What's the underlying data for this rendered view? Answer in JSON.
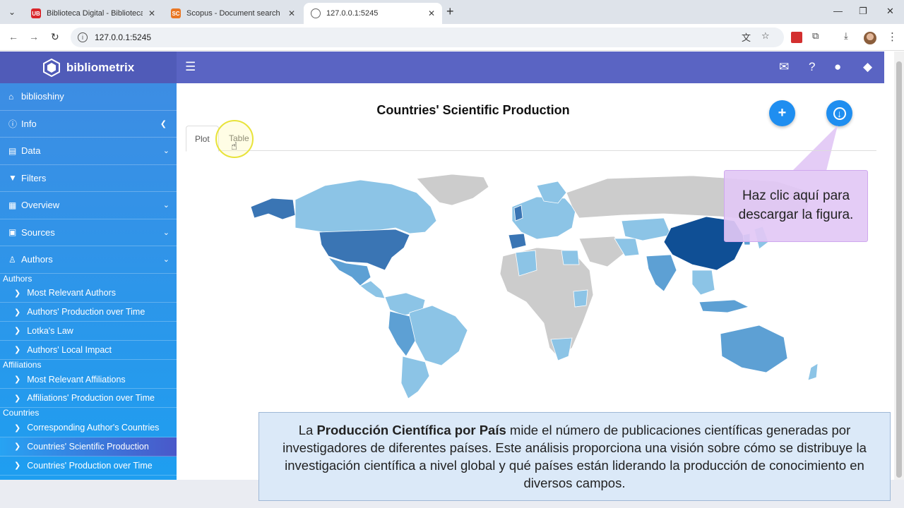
{
  "browser": {
    "tabs": [
      {
        "title": "Biblioteca Digital - Biblioteca -",
        "favicon_text": "UB",
        "color": "#d9262b"
      },
      {
        "title": "Scopus - Document search resu",
        "favicon_text": "SC",
        "color": "#e97724"
      },
      {
        "title": "127.0.0.1:5245",
        "favicon_text": "",
        "color": "#666666"
      }
    ],
    "url": "127.0.0.1:5245"
  },
  "app": {
    "brand": "bibliometrix",
    "colors": {
      "header": "#5a64c3",
      "sidebar_top": "#3d8de3",
      "sidebar_bottom": "#1e9ef0",
      "fab": "#1f8ef0"
    }
  },
  "sidebar": {
    "top_items": [
      {
        "label": "biblioshiny",
        "icon": "home-icon"
      },
      {
        "label": "Info",
        "icon": "info-icon",
        "chevron": "left"
      },
      {
        "label": "Data",
        "icon": "file-import-icon",
        "chevron": "down"
      },
      {
        "label": "Filters",
        "icon": "filter-icon"
      },
      {
        "label": "Overview",
        "icon": "table-icon",
        "chevron": "down"
      },
      {
        "label": "Sources",
        "icon": "book-icon",
        "chevron": "down"
      },
      {
        "label": "Authors",
        "icon": "user-icon",
        "chevron": "down"
      }
    ],
    "groups": [
      {
        "heading": "Authors",
        "items": [
          "Most Relevant Authors",
          "Authors' Production over Time",
          "Lotka's Law",
          "Authors' Local Impact"
        ]
      },
      {
        "heading": "Affiliations",
        "items": [
          "Most Relevant Affiliations",
          "Affiliations' Production over Time"
        ]
      },
      {
        "heading": "Countries",
        "items": [
          "Corresponding Author's Countries",
          "Countries' Scientific Production",
          "Countries' Production over Time"
        ]
      }
    ],
    "active_item": "Countries' Scientific Production"
  },
  "main": {
    "title": "Countries' Scientific Production",
    "tabs": [
      "Plot",
      "Table"
    ],
    "active_tab": "Plot",
    "map_colors": {
      "none": "#cccccc",
      "low": "#8cc4e6",
      "mid": "#5da0d4",
      "high": "#3a75b4",
      "max": "#0f4f95"
    },
    "tooltip": "Haz clic aquí para descargar la figura."
  },
  "caption": {
    "before": "La ",
    "bold": "Producción Científica por País",
    "after": " mide el número de publicaciones científicas generadas por investigadores de diferentes países. Este análisis proporciona una visión sobre cómo se distribuye la investigación científica a nivel global y qué países están liderando la producción de conocimiento en diversos campos."
  }
}
